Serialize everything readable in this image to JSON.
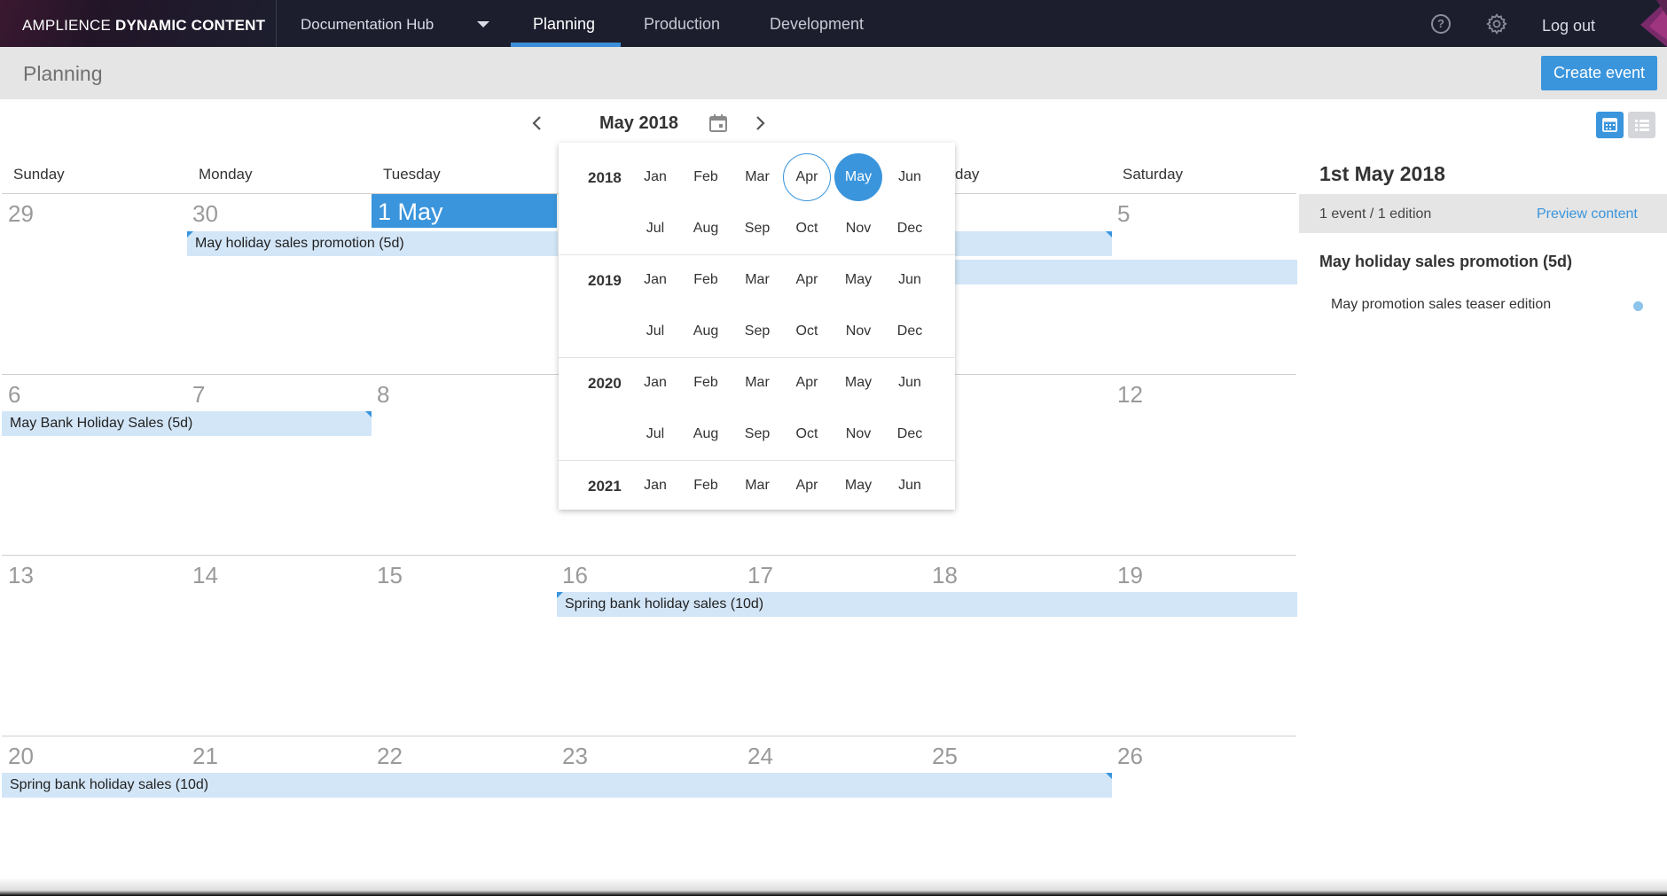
{
  "app": {
    "brand_light": "AMPLIENCE ",
    "brand_bold": "DYNAMIC CONTENT",
    "hub_name": "Documentation Hub",
    "tabs": [
      "Planning",
      "Production",
      "Development"
    ],
    "logout": "Log out"
  },
  "header": {
    "title": "Planning",
    "create_event": "Create event"
  },
  "calendar": {
    "month_label": "May 2018",
    "weekdays": [
      "Sunday",
      "Monday",
      "Tuesday",
      "day",
      "Saturday"
    ],
    "today_label": "1 May",
    "days": [
      "29",
      "30",
      "5",
      "6",
      "7",
      "8",
      "12",
      "13",
      "14",
      "15",
      "16",
      "17",
      "18",
      "19",
      "20",
      "21",
      "22",
      "23",
      "24",
      "25",
      "26"
    ],
    "events": [
      "May holiday sales promotion (5d)",
      "May Bank Holiday Sales (5d)",
      "Spring bank holiday sales (10d)",
      "Spring bank holiday sales (10d)"
    ]
  },
  "picker": {
    "years": [
      "2018",
      "2019",
      "2020",
      "2021"
    ],
    "months_row1": [
      "Jan",
      "Feb",
      "Mar",
      "Apr",
      "May",
      "Jun"
    ],
    "months_row2": [
      "Jul",
      "Aug",
      "Sep",
      "Oct",
      "Nov",
      "Dec"
    ],
    "current_month": "Apr",
    "selected_month": "May",
    "selected_year": "2018"
  },
  "side_panel": {
    "date": "1st May 2018",
    "summary": "1 event / 1 edition",
    "preview": "Preview content",
    "event_name": "May holiday sales promotion  (5d)",
    "edition": "May promotion sales teaser edition"
  },
  "colors": {
    "accent": "#3a95dc",
    "event_bar": "#d3e6f8",
    "topbar": "#1c1e2e",
    "edition_status_dot": "#8cc4ec"
  },
  "icons": [
    "help-icon",
    "gear-icon",
    "chevron-left-icon",
    "calendar-icon",
    "chevron-right-icon",
    "calendar-view-icon",
    "list-view-icon"
  ]
}
